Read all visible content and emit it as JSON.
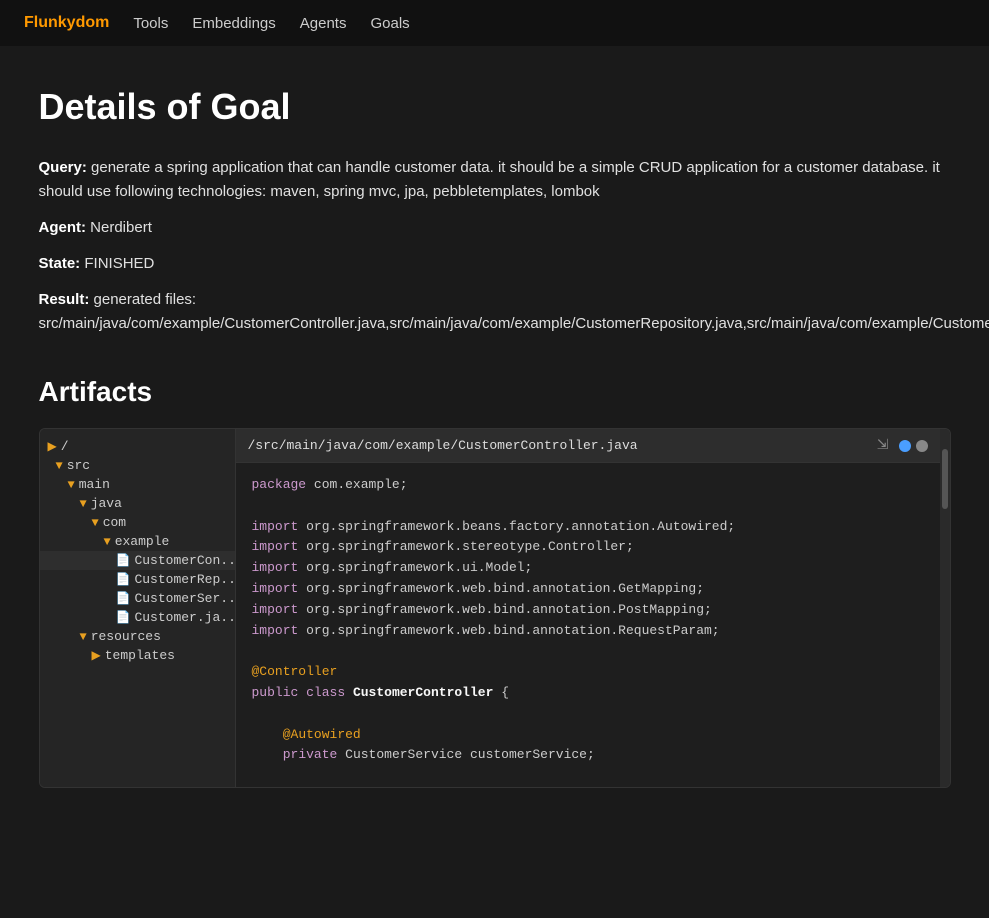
{
  "nav": {
    "brand": "Flunkydom",
    "links": [
      "Tools",
      "Embeddings",
      "Agents",
      "Goals"
    ]
  },
  "page": {
    "title": "Details of Goal",
    "query_label": "Query:",
    "query_text": "generate a spring application that can handle customer data. it should be a simple CRUD application for a customer database. it should use following technologies: maven, spring mvc, jpa, pebbletemplates, lombok",
    "agent_label": "Agent:",
    "agent_value": "Nerdibert",
    "state_label": "State:",
    "state_value": "FINISHED",
    "result_label": "Result:",
    "result_text": "generated files:",
    "result_files": "src/main/java/com/example/CustomerController.java,src/main/java/com/example/CustomerRepository.java,src/main/java/com/example/CustomerService.java,src/main/java/com/example/Customer.java,src/main/resources/application.properties,src/main/resources/templates/index.html,src/main/resources/templates/customer.html,src/main/resources/static/css/style.css,src/main/resources/static/js/script.js,pom.xml",
    "artifacts_title": "Artifacts"
  },
  "filetree": {
    "items": [
      {
        "label": "/",
        "indent": 0,
        "type": "folder"
      },
      {
        "label": "src",
        "indent": 1,
        "type": "folder"
      },
      {
        "label": "main",
        "indent": 2,
        "type": "folder"
      },
      {
        "label": "java",
        "indent": 3,
        "type": "folder"
      },
      {
        "label": "com",
        "indent": 4,
        "type": "folder"
      },
      {
        "label": "example",
        "indent": 5,
        "type": "folder"
      },
      {
        "label": "CustomerCon...",
        "indent": 6,
        "type": "file"
      },
      {
        "label": "CustomerRep...",
        "indent": 6,
        "type": "file"
      },
      {
        "label": "CustomerSer...",
        "indent": 6,
        "type": "file"
      },
      {
        "label": "Customer.ja...",
        "indent": 6,
        "type": "file"
      },
      {
        "label": "resources",
        "indent": 3,
        "type": "folder"
      },
      {
        "label": "templates",
        "indent": 4,
        "type": "folder"
      }
    ]
  },
  "code": {
    "filename": "/src/main/java/com/example/CustomerController.java",
    "content": "package com.example;\n\nimport org.springframework.beans.factory.annotation.Autowired;\nimport org.springframework.stereotype.Controller;\nimport org.springframework.ui.Model;\nimport org.springframework.web.bind.annotation.GetMapping;\nimport org.springframework.web.bind.annotation.PostMapping;\nimport org.springframework.web.bind.annotation.RequestParam;\n\n@Controller\npublic class CustomerController {\n\n    @Autowired\n    private CustomerService customerService;\n\n    @GetMapping(\"/\")\n    public String index(Model model) {\n        model.addAttribute(\"customers\", customerService.getAllCustomers());\n        return \"index\";\n    }"
  },
  "colors": {
    "brand": "#f90",
    "nav_bg": "#111111",
    "page_bg": "#1a1a1a",
    "code_bg": "#1e1e1e",
    "tree_bg": "#252525",
    "header_bg": "#2d2d2d"
  }
}
